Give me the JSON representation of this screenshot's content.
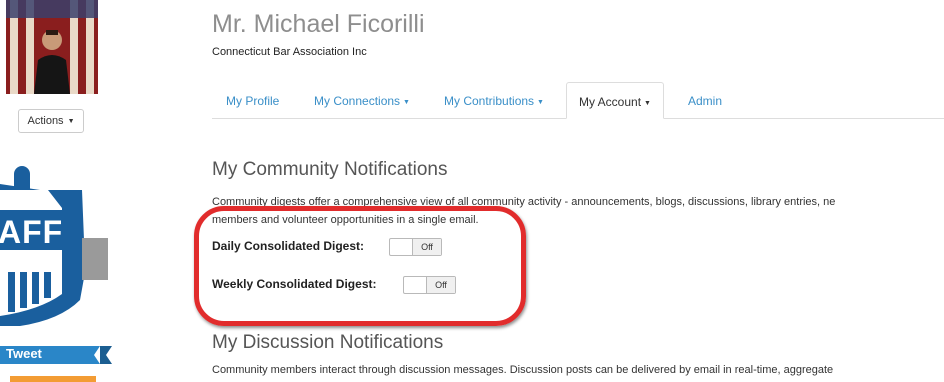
{
  "profile": {
    "name": "Mr. Michael Ficorilli",
    "organization": "Connecticut Bar Association Inc",
    "actions_label": "Actions"
  },
  "social": {
    "badge_text": "AFF",
    "tweet_label": "Tweet"
  },
  "tabs": [
    {
      "label": "My Profile",
      "has_dropdown": false,
      "active": false
    },
    {
      "label": "My Connections",
      "has_dropdown": true,
      "active": false
    },
    {
      "label": "My Contributions",
      "has_dropdown": true,
      "active": false
    },
    {
      "label": "My Account",
      "has_dropdown": true,
      "active": true
    },
    {
      "label": "Admin",
      "has_dropdown": false,
      "active": false
    }
  ],
  "community_notifications": {
    "title": "My Community Notifications",
    "description_line1": "Community digests offer a comprehensive view of all community activity - announcements, blogs, discussions, library entries, ne",
    "description_line2": "members and volunteer opportunities in a single email.",
    "daily_label": "Daily Consolidated Digest:",
    "daily_state": "Off",
    "weekly_label": "Weekly Consolidated Digest:",
    "weekly_state": "Off"
  },
  "discussion_notifications": {
    "title": "My Discussion Notifications",
    "description": "Community members interact through discussion messages. Discussion posts can be delivered by email in real-time, aggregate"
  },
  "colors": {
    "link": "#3a8fc8",
    "annotation": "#e12c2c",
    "badge_blue": "#1a5f9e",
    "tweet_ribbon": "#2a86c8"
  }
}
